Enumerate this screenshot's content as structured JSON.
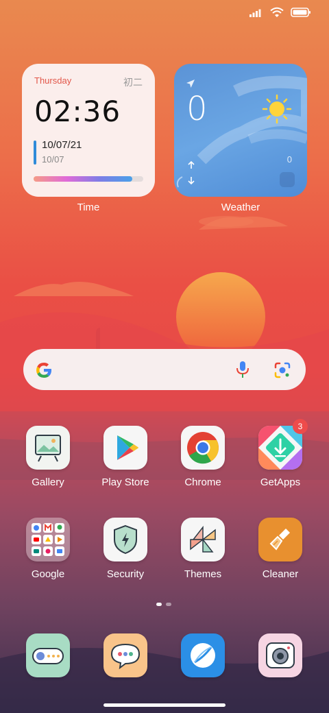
{
  "status_bar": {
    "icons": [
      "signal-icon",
      "wifi-icon",
      "battery-icon"
    ]
  },
  "time_widget": {
    "day": "Thursday",
    "lunar_date": "初二",
    "time": "02:36",
    "date_primary": "10/07/21",
    "date_secondary": "10/07",
    "label": "Time"
  },
  "weather_widget": {
    "temperature": "0",
    "secondary_value": "0",
    "label": "Weather",
    "icons": [
      "location-arrow-icon",
      "sun-icon",
      "up-arrow-icon",
      "down-arrow-icon"
    ]
  },
  "search_bar": {
    "icons": [
      "google-logo-icon",
      "microphone-icon",
      "lens-camera-icon"
    ]
  },
  "apps": [
    {
      "label": "Gallery",
      "icon": "gallery-icon"
    },
    {
      "label": "Play Store",
      "icon": "play-store-icon"
    },
    {
      "label": "Chrome",
      "icon": "chrome-icon"
    },
    {
      "label": "GetApps",
      "icon": "getapps-icon",
      "badge": "3"
    },
    {
      "label": "Google",
      "icon": "google-folder-icon"
    },
    {
      "label": "Security",
      "icon": "security-shield-icon"
    },
    {
      "label": "Themes",
      "icon": "themes-icon"
    },
    {
      "label": "Cleaner",
      "icon": "cleaner-brush-icon"
    }
  ],
  "dock": [
    {
      "icon": "phone-icon"
    },
    {
      "icon": "messaging-icon"
    },
    {
      "icon": "browser-icon"
    },
    {
      "icon": "camera-icon"
    }
  ],
  "page_indicator": {
    "pages": 2,
    "current": 1
  },
  "colors": {
    "accent_red": "#e2574a",
    "badge": "#ee4b4b",
    "progress_blue": "#2f8bd9"
  }
}
